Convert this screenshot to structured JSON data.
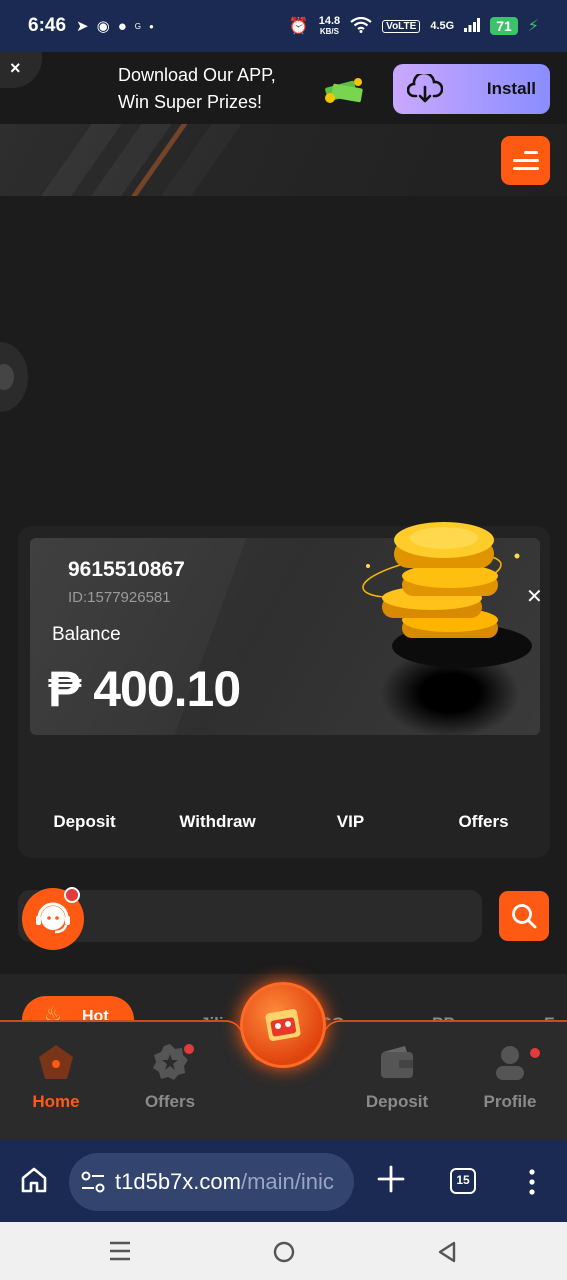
{
  "status_bar": {
    "time": "6:46",
    "net_speed": "14.8",
    "net_unit": "KB/S",
    "volte": "VoLTE",
    "signal": "4.5G",
    "battery": "71"
  },
  "app_banner": {
    "line1": "Download Our APP,",
    "line2": "Win Super Prizes!",
    "install_label": "Install",
    "close_glyph": "×"
  },
  "account": {
    "phone": "9615510867",
    "id": "ID:1577926581",
    "balance_label": "Balance",
    "balance": "₱ 400.10"
  },
  "card_actions": [
    "Deposit",
    "Withdraw",
    "VIP",
    "Offers"
  ],
  "categories": {
    "hot": "Hot",
    "items": [
      "Jili",
      "PG",
      "PP",
      "F"
    ]
  },
  "bottom_nav": {
    "home": "Home",
    "offers": "Offers",
    "deposit": "Deposit",
    "profile": "Profile"
  },
  "browser": {
    "url_host": "t1d5b7x.com",
    "url_path": "/main/inic",
    "tab_count": "15"
  },
  "colors": {
    "accent": "#ff5a14",
    "status_bar": "#1b2a52",
    "background": "#1c1c1c"
  }
}
